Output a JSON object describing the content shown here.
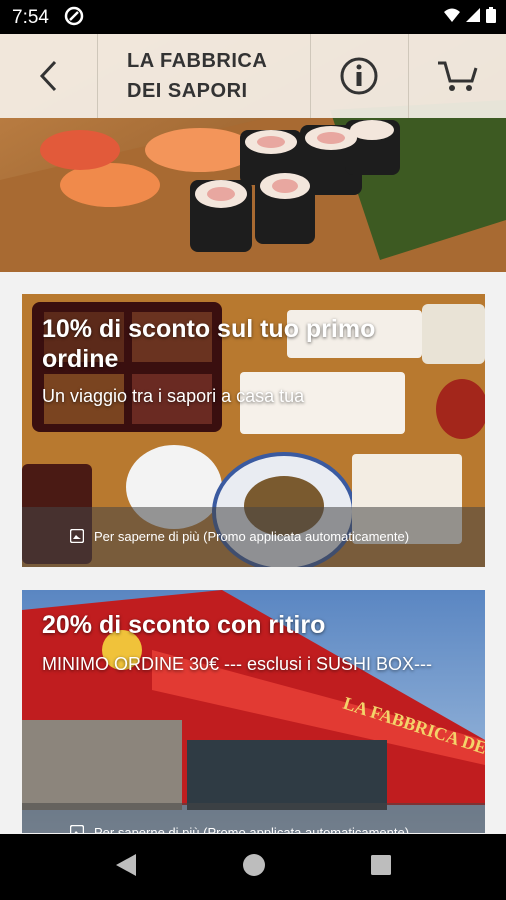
{
  "status_bar": {
    "time": "7:54"
  },
  "header": {
    "title_line1": "LA FABBRICA",
    "title_line2": "DEI SAPORI"
  },
  "promos": [
    {
      "title_line1": "10% di sconto sul tuo primo",
      "title_line2": "ordine",
      "subtitle": "Un viaggio tra i sapori a casa tua",
      "footer": "Per saperne di più (Promo applicata automaticamente)"
    },
    {
      "title": "20% di sconto con ritiro",
      "subtitle": "MINIMO ORDINE 30€ --- esclusi i SUSHI BOX---",
      "footer": "Per saperne di più (Promo applicata automaticamente)",
      "sign_text": "LA FABBRICA DEI SAPORI"
    }
  ],
  "icons": {
    "status": [
      "at-sign-icon",
      "wifi-icon",
      "signal-icon",
      "battery-icon"
    ],
    "header": [
      "back-arrow-icon",
      "info-icon",
      "cart-icon"
    ],
    "nav": [
      "nav-back-icon",
      "nav-home-icon",
      "nav-recents-icon"
    ]
  }
}
